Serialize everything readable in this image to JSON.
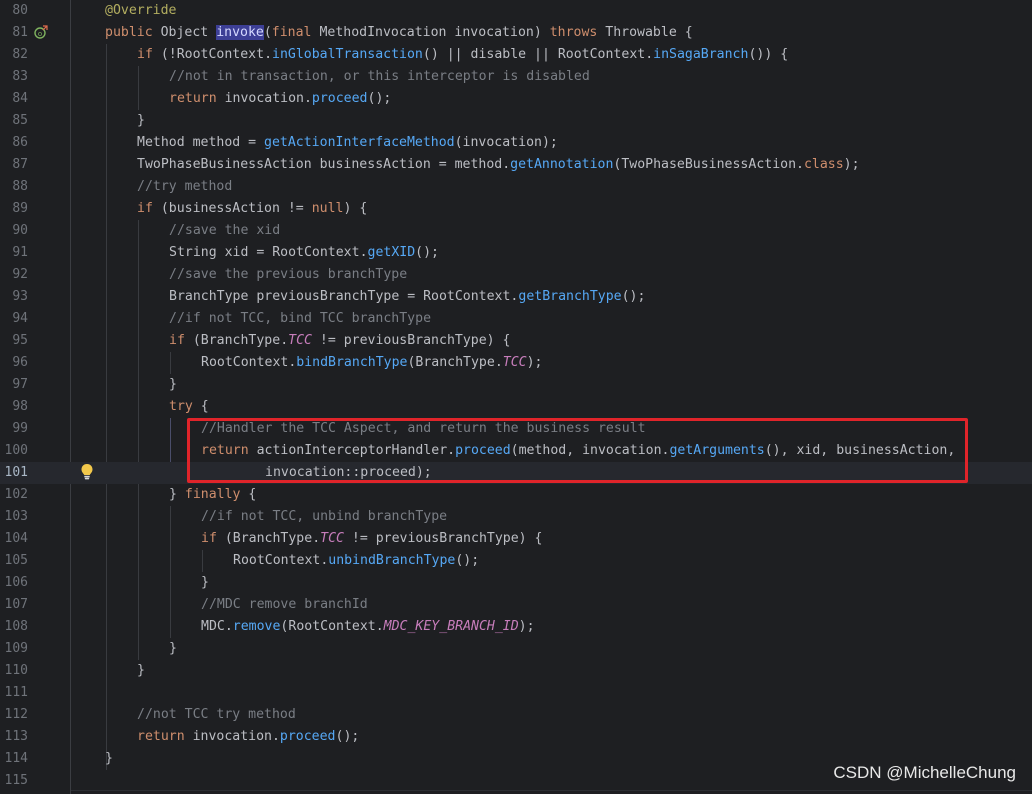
{
  "editor": {
    "lines": [
      {
        "num": "80",
        "text": "@Override",
        "indent": 0
      },
      {
        "num": "81",
        "text": "public Object invoke(final MethodInvocation invocation) throws Throwable {",
        "indent": 0
      },
      {
        "num": "82",
        "text": "if (!RootContext.inGlobalTransaction() || disable || RootContext.inSagaBranch()) {",
        "indent": 1
      },
      {
        "num": "83",
        "text": "//not in transaction, or this interceptor is disabled",
        "indent": 2
      },
      {
        "num": "84",
        "text": "return invocation.proceed();",
        "indent": 2
      },
      {
        "num": "85",
        "text": "}",
        "indent": 1
      },
      {
        "num": "86",
        "text": "Method method = getActionInterfaceMethod(invocation);",
        "indent": 1
      },
      {
        "num": "87",
        "text": "TwoPhaseBusinessAction businessAction = method.getAnnotation(TwoPhaseBusinessAction.class);",
        "indent": 1
      },
      {
        "num": "88",
        "text": "//try method",
        "indent": 1
      },
      {
        "num": "89",
        "text": "if (businessAction != null) {",
        "indent": 1
      },
      {
        "num": "90",
        "text": "//save the xid",
        "indent": 2
      },
      {
        "num": "91",
        "text": "String xid = RootContext.getXID();",
        "indent": 2
      },
      {
        "num": "92",
        "text": "//save the previous branchType",
        "indent": 2
      },
      {
        "num": "93",
        "text": "BranchType previousBranchType = RootContext.getBranchType();",
        "indent": 2
      },
      {
        "num": "94",
        "text": "//if not TCC, bind TCC branchType",
        "indent": 2
      },
      {
        "num": "95",
        "text": "if (BranchType.TCC != previousBranchType) {",
        "indent": 2
      },
      {
        "num": "96",
        "text": "RootContext.bindBranchType(BranchType.TCC);",
        "indent": 3
      },
      {
        "num": "97",
        "text": "}",
        "indent": 2
      },
      {
        "num": "98",
        "text": "try {",
        "indent": 2
      },
      {
        "num": "99",
        "text": "//Handler the TCC Aspect, and return the business result",
        "indent": 3
      },
      {
        "num": "100",
        "text": "return actionInterceptorHandler.proceed(method, invocation.getArguments(), xid, businessAction,",
        "indent": 3
      },
      {
        "num": "101",
        "text": "invocation::proceed);",
        "indent": 5
      },
      {
        "num": "102",
        "text": "} finally {",
        "indent": 2
      },
      {
        "num": "103",
        "text": "//if not TCC, unbind branchType",
        "indent": 3
      },
      {
        "num": "104",
        "text": "if (BranchType.TCC != previousBranchType) {",
        "indent": 3
      },
      {
        "num": "105",
        "text": "RootContext.unbindBranchType();",
        "indent": 4
      },
      {
        "num": "106",
        "text": "}",
        "indent": 3
      },
      {
        "num": "107",
        "text": "//MDC remove branchId",
        "indent": 3
      },
      {
        "num": "108",
        "text": "MDC.remove(RootContext.MDC_KEY_BRANCH_ID);",
        "indent": 3
      },
      {
        "num": "109",
        "text": "}",
        "indent": 2
      },
      {
        "num": "110",
        "text": "}",
        "indent": 1
      },
      {
        "num": "111",
        "text": "",
        "indent": 0
      },
      {
        "num": "112",
        "text": "//not TCC try method",
        "indent": 1
      },
      {
        "num": "113",
        "text": "return invocation.proceed();",
        "indent": 1
      },
      {
        "num": "114",
        "text": "}",
        "indent": 0
      },
      {
        "num": "115",
        "text": "",
        "indent": 0
      }
    ],
    "current_line": "101",
    "selected_word": "invoke"
  },
  "icons": {
    "override": "override-gutter-icon",
    "intention": "lightbulb-icon"
  },
  "colors": {
    "background": "#1e1f22",
    "highlight_box": "#e0242a",
    "keyword": "#cf8e6d",
    "method": "#56a8f5",
    "comment": "#7a7e85",
    "annotation": "#b3ae60",
    "constant": "#c77dbb"
  },
  "watermark": {
    "text": "CSDN @MichelleChung"
  }
}
